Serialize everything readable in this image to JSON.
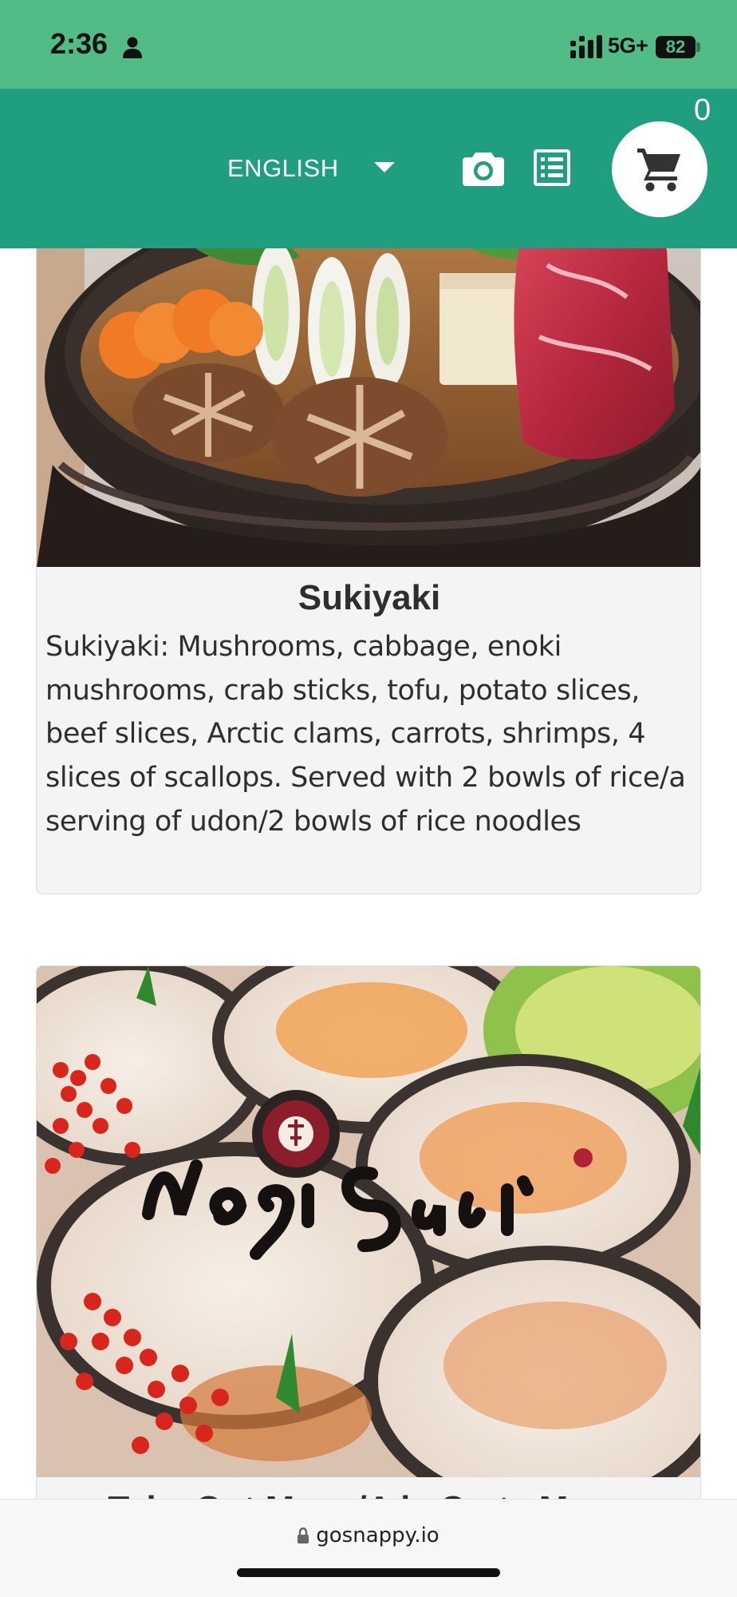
{
  "status_bar": {
    "time": "2:36",
    "network": "5G+",
    "battery": "82"
  },
  "header": {
    "language": "ENGLISH",
    "cart_count": "0",
    "icons": [
      "camera-icon",
      "menu-list-icon",
      "cart-icon",
      "chevron-down-icon"
    ],
    "colors": {
      "status_bar": "#52bc86",
      "header": "#1f9e80"
    }
  },
  "items": [
    {
      "title": "Sukiyaki",
      "description": "Sukiyaki: Mushrooms, cabbage, enoki mushrooms, crab sticks, tofu, potato slices, beef slices, Arctic clams, carrots, shrimps, 4 slices of scallops. Served with 2 bowls of rice/a serving of udon/2 bowls of rice noodles"
    },
    {
      "title": "Take Out Menu/A la Carte Menu",
      "logo_text": "Nogi Sushi"
    }
  ],
  "browser": {
    "url": "gosnappy.io"
  }
}
